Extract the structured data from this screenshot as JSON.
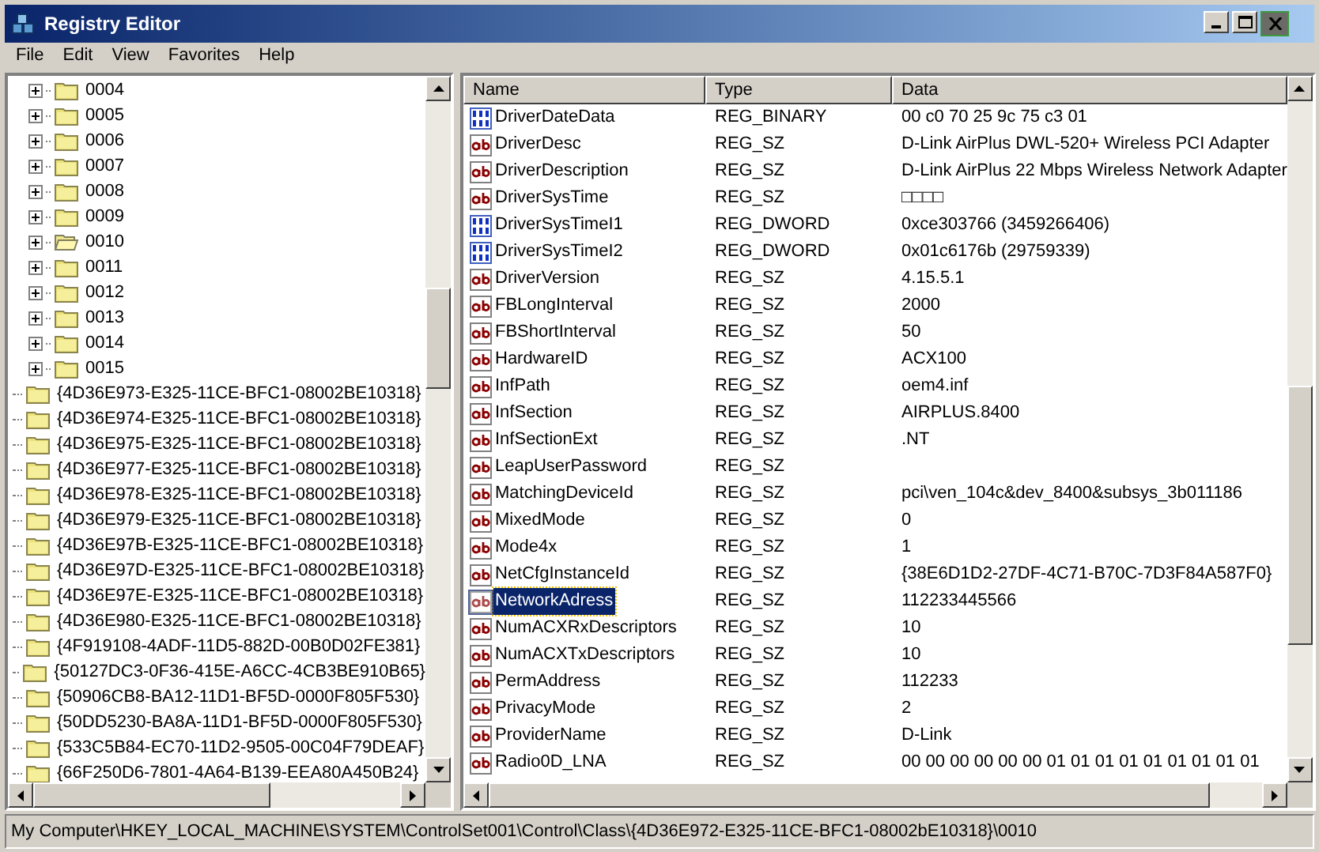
{
  "window": {
    "title": "Registry Editor"
  },
  "menu": [
    "File",
    "Edit",
    "View",
    "Favorites",
    "Help"
  ],
  "tree": {
    "subkeys": [
      {
        "label": "0004",
        "open": false
      },
      {
        "label": "0005",
        "open": false
      },
      {
        "label": "0006",
        "open": false
      },
      {
        "label": "0007",
        "open": false
      },
      {
        "label": "0008",
        "open": false
      },
      {
        "label": "0009",
        "open": false
      },
      {
        "label": "0010",
        "open": true
      },
      {
        "label": "0011",
        "open": false
      },
      {
        "label": "0012",
        "open": false
      },
      {
        "label": "0013",
        "open": false
      },
      {
        "label": "0014",
        "open": false
      },
      {
        "label": "0015",
        "open": false
      }
    ],
    "keys": [
      {
        "label": "{4D36E973-E325-11CE-BFC1-08002BE10318}"
      },
      {
        "label": "{4D36E974-E325-11CE-BFC1-08002BE10318}"
      },
      {
        "label": "{4D36E975-E325-11CE-BFC1-08002BE10318}"
      },
      {
        "label": "{4D36E977-E325-11CE-BFC1-08002BE10318}"
      },
      {
        "label": "{4D36E978-E325-11CE-BFC1-08002BE10318}"
      },
      {
        "label": "{4D36E979-E325-11CE-BFC1-08002BE10318}"
      },
      {
        "label": "{4D36E97B-E325-11CE-BFC1-08002BE10318}"
      },
      {
        "label": "{4D36E97D-E325-11CE-BFC1-08002BE10318}"
      },
      {
        "label": "{4D36E97E-E325-11CE-BFC1-08002BE10318}"
      },
      {
        "label": "{4D36E980-E325-11CE-BFC1-08002BE10318}"
      },
      {
        "label": "{4F919108-4ADF-11D5-882D-00B0D02FE381}"
      },
      {
        "label": "{50127DC3-0F36-415E-A6CC-4CB3BE910B65}"
      },
      {
        "label": "{50906CB8-BA12-11D1-BF5D-0000F805F530}"
      },
      {
        "label": "{50DD5230-BA8A-11D1-BF5D-0000F805F530}"
      },
      {
        "label": "{533C5B84-EC70-11D2-9505-00C04F79DEAF}"
      },
      {
        "label": "{66F250D6-7801-4A64-B139-EEA80A450B24}"
      }
    ]
  },
  "values": {
    "columns": [
      "Name",
      "Type",
      "Data"
    ],
    "rows": [
      {
        "kind": "binary",
        "name": "DriverDateData",
        "type": "REG_BINARY",
        "data": "00 c0 70 25 9c 75 c3 01",
        "selected": false
      },
      {
        "kind": "string",
        "name": "DriverDesc",
        "type": "REG_SZ",
        "data": "D-Link AirPlus DWL-520+ Wireless PCI Adapter",
        "selected": false
      },
      {
        "kind": "string",
        "name": "DriverDescription",
        "type": "REG_SZ",
        "data": "D-Link AirPlus 22 Mbps Wireless Network Adapter",
        "selected": false
      },
      {
        "kind": "string",
        "name": "DriverSysTime",
        "type": "REG_SZ",
        "data": "□□□□",
        "selected": false
      },
      {
        "kind": "binary",
        "name": "DriverSysTimeI1",
        "type": "REG_DWORD",
        "data": "0xce303766 (3459266406)",
        "selected": false
      },
      {
        "kind": "binary",
        "name": "DriverSysTimeI2",
        "type": "REG_DWORD",
        "data": "0x01c6176b (29759339)",
        "selected": false
      },
      {
        "kind": "string",
        "name": "DriverVersion",
        "type": "REG_SZ",
        "data": "4.15.5.1",
        "selected": false
      },
      {
        "kind": "string",
        "name": "FBLongInterval",
        "type": "REG_SZ",
        "data": "2000",
        "selected": false
      },
      {
        "kind": "string",
        "name": "FBShortInterval",
        "type": "REG_SZ",
        "data": "50",
        "selected": false
      },
      {
        "kind": "string",
        "name": "HardwareID",
        "type": "REG_SZ",
        "data": "ACX100",
        "selected": false
      },
      {
        "kind": "string",
        "name": "InfPath",
        "type": "REG_SZ",
        "data": "oem4.inf",
        "selected": false
      },
      {
        "kind": "string",
        "name": "InfSection",
        "type": "REG_SZ",
        "data": "AIRPLUS.8400",
        "selected": false
      },
      {
        "kind": "string",
        "name": "InfSectionExt",
        "type": "REG_SZ",
        "data": ".NT",
        "selected": false
      },
      {
        "kind": "string",
        "name": "LeapUserPassword",
        "type": "REG_SZ",
        "selected": false
      },
      {
        "kind": "string",
        "name": "MatchingDeviceId",
        "type": "REG_SZ",
        "data": "pci\\ven_104c&dev_8400&subsys_3b011186",
        "selected": false
      },
      {
        "kind": "string",
        "name": "MixedMode",
        "type": "REG_SZ",
        "data": "0",
        "selected": false
      },
      {
        "kind": "string",
        "name": "Mode4x",
        "type": "REG_SZ",
        "data": "1",
        "selected": false
      },
      {
        "kind": "string",
        "name": "NetCfgInstanceId",
        "type": "REG_SZ",
        "data": "{38E6D1D2-27DF-4C71-B70C-7D3F84A587F0}",
        "selected": false
      },
      {
        "kind": "string",
        "name": "NetworkAdress",
        "type": "REG_SZ",
        "data": "112233445566",
        "selected": true
      },
      {
        "kind": "string",
        "name": "NumACXRxDescriptors",
        "type": "REG_SZ",
        "data": "10",
        "selected": false
      },
      {
        "kind": "string",
        "name": "NumACXTxDescriptors",
        "type": "REG_SZ",
        "data": "10",
        "selected": false
      },
      {
        "kind": "string",
        "name": "PermAddress",
        "type": "REG_SZ",
        "data": "112233",
        "selected": false
      },
      {
        "kind": "string",
        "name": "PrivacyMode",
        "type": "REG_SZ",
        "data": "2",
        "selected": false
      },
      {
        "kind": "string",
        "name": "ProviderName",
        "type": "REG_SZ",
        "data": "D-Link",
        "selected": false
      },
      {
        "kind": "string",
        "name": "Radio0D_LNA",
        "type": "REG_SZ",
        "data": "00 00 00 00 00 00 01 01 01 01 01 01 01 01 01",
        "selected": false
      }
    ]
  },
  "status_bar": "My Computer\\HKEY_LOCAL_MACHINE\\SYSTEM\\ControlSet001\\Control\\Class\\{4D36E972-E325-11CE-BFC1-08002bE10318}\\0010"
}
